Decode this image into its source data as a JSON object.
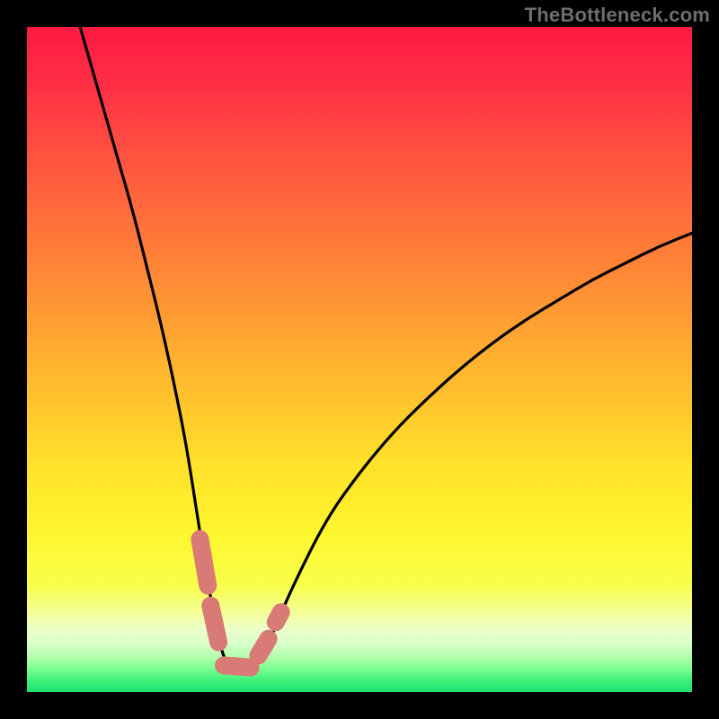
{
  "watermark": "TheBottleneck.com",
  "chart_data": {
    "type": "line",
    "title": "",
    "xlabel": "",
    "ylabel": "",
    "xlim": [
      0,
      100
    ],
    "ylim": [
      0,
      100
    ],
    "grid": false,
    "series": [
      {
        "name": "bottleneck-curve",
        "x": [
          8,
          10,
          12,
          14,
          16,
          18,
          20,
          22,
          24,
          26,
          27.8,
          29,
          30.3,
          32.2,
          33.8,
          35.4,
          37,
          40,
          45,
          50,
          55,
          60,
          65,
          70,
          75,
          80,
          85,
          90,
          95,
          100
        ],
        "y": [
          100,
          93,
          86,
          79,
          72,
          64,
          56,
          47,
          37,
          24,
          13,
          7,
          3.5,
          3.3,
          3.5,
          5,
          9,
          16,
          26,
          33,
          39,
          44,
          48.5,
          52.5,
          56,
          59,
          62,
          64.5,
          67,
          69
        ]
      }
    ],
    "markers": [
      {
        "name": "seg-left-upper",
        "x1": 26.0,
        "y1": 23.0,
        "x2": 27.2,
        "y2": 16.0
      },
      {
        "name": "seg-left-lower",
        "x1": 27.6,
        "y1": 13.0,
        "x2": 28.8,
        "y2": 7.5
      },
      {
        "name": "seg-bottom",
        "x1": 29.6,
        "y1": 4.0,
        "x2": 33.6,
        "y2": 3.7
      },
      {
        "name": "seg-right-lower",
        "x1": 34.8,
        "y1": 5.5,
        "x2": 36.3,
        "y2": 8.0
      },
      {
        "name": "dot-right-upper",
        "x1": 37.4,
        "y1": 10.5,
        "x2": 38.2,
        "y2": 12.0
      }
    ],
    "marker_color": "#d87a76",
    "gradient_stops": [
      {
        "pos": 0.0,
        "color": "#ff1a42"
      },
      {
        "pos": 0.08,
        "color": "#ff2d45"
      },
      {
        "pos": 0.22,
        "color": "#ff5a3e"
      },
      {
        "pos": 0.38,
        "color": "#ff8b36"
      },
      {
        "pos": 0.52,
        "color": "#ffb72e"
      },
      {
        "pos": 0.66,
        "color": "#ffe22a"
      },
      {
        "pos": 0.76,
        "color": "#fff62f"
      },
      {
        "pos": 0.84,
        "color": "#f7ff4a"
      },
      {
        "pos": 0.885,
        "color": "#f3ffa0"
      },
      {
        "pos": 0.905,
        "color": "#ecffc8"
      },
      {
        "pos": 0.925,
        "color": "#dcffcc"
      },
      {
        "pos": 0.945,
        "color": "#b8ffb0"
      },
      {
        "pos": 0.965,
        "color": "#7dff90"
      },
      {
        "pos": 0.985,
        "color": "#35f07a"
      },
      {
        "pos": 1.0,
        "color": "#20e070"
      }
    ]
  }
}
